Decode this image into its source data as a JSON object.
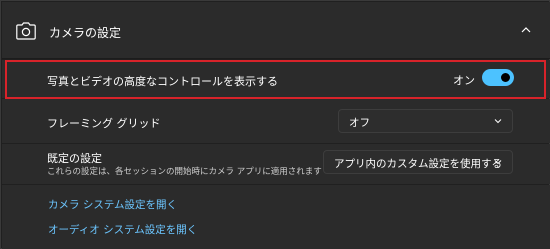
{
  "header": {
    "title": "カメラの設定",
    "icon": "camera-icon",
    "collapse_icon": "chevron-up-icon"
  },
  "settings": {
    "advanced_controls": {
      "label": "写真とビデオの高度なコントロールを表示する",
      "toggle_state_text": "オン",
      "toggle_on": true
    },
    "framing_grid": {
      "label": "フレーミング グリッド",
      "selected": "オフ"
    },
    "default_settings": {
      "label": "既定の設定",
      "description": "これらの設定は、各セッションの開始時にカメラ アプリに適用されます",
      "selected": "アプリ内のカスタム設定を使用する"
    }
  },
  "links": {
    "camera_system": "カメラ システム設定を開く",
    "audio_system": "オーディオ システム設定を開く"
  },
  "colors": {
    "accent": "#4cc2ff",
    "link": "#6cc6ff",
    "highlight_border": "#d8232a",
    "panel": "#2b2b2b",
    "background": "#202020"
  }
}
